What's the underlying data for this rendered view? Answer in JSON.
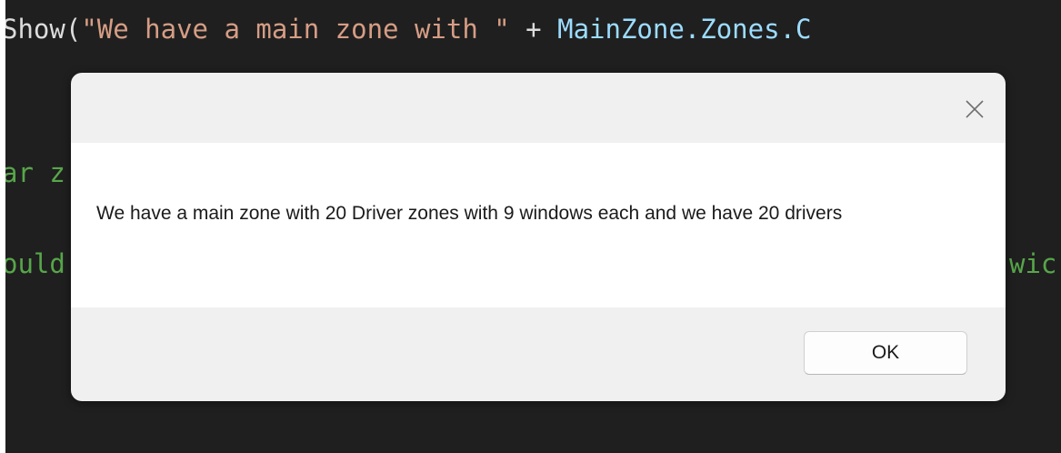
{
  "editor": {
    "line1": {
      "method": "Show(",
      "string": "\"We have a main zone with \"",
      "operator": " + ",
      "member": "MainZone.Zones.C"
    },
    "line2_fragment": "ar z",
    "line3_left_fragment": "ould",
    "line3_right_fragment": "wic"
  },
  "dialog": {
    "close_icon": "close-icon",
    "message": "We have a main zone with 20 Driver zones with 9 windows each and we have 20 drivers",
    "ok_label": "OK"
  },
  "colors": {
    "editor_background": "#1f1f1f",
    "code_string": "#d69d85",
    "code_member": "#9cdcfe",
    "code_comment": "#57a64a",
    "dialog_background": "#f0f0f0",
    "dialog_body": "#ffffff"
  }
}
